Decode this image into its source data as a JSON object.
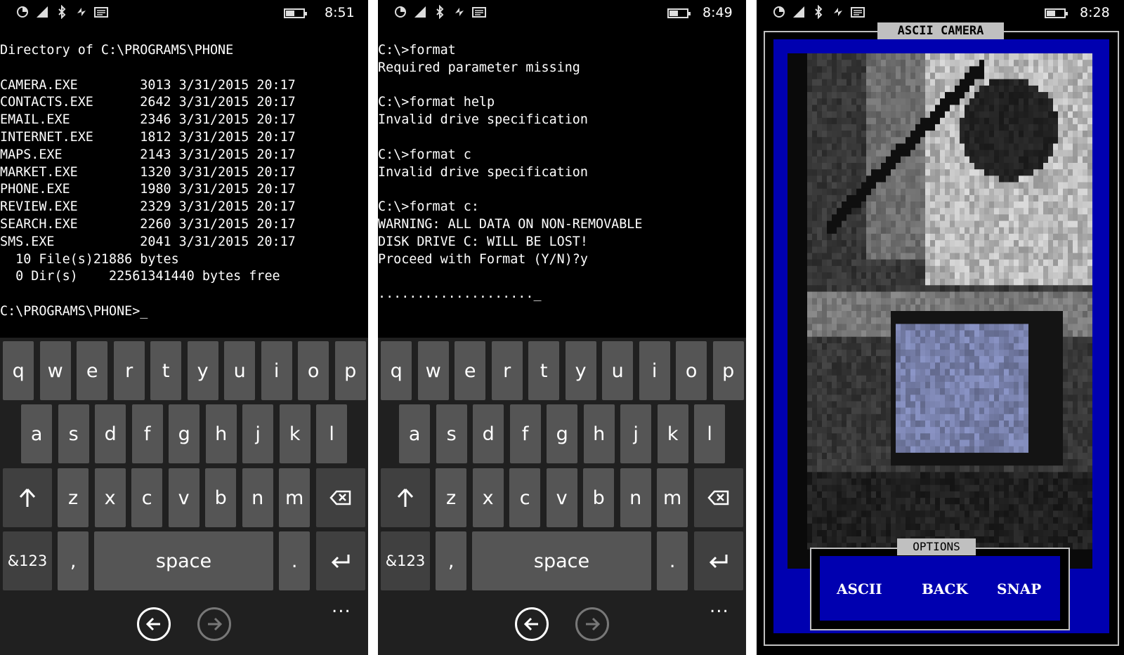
{
  "screens": [
    {
      "status": {
        "time": "8:51",
        "battery_level": 0.45
      },
      "terminal_lines": [
        "Directory of C:\\PROGRAMS\\PHONE",
        "",
        "CAMERA.EXE        3013 3/31/2015 20:17",
        "CONTACTS.EXE      2642 3/31/2015 20:17",
        "EMAIL.EXE         2346 3/31/2015 20:17",
        "INTERNET.EXE      1812 3/31/2015 20:17",
        "MAPS.EXE          2143 3/31/2015 20:17",
        "MARKET.EXE        1320 3/31/2015 20:17",
        "PHONE.EXE         1980 3/31/2015 20:17",
        "REVIEW.EXE        2329 3/31/2015 20:17",
        "SEARCH.EXE        2260 3/31/2015 20:17",
        "SMS.EXE           2041 3/31/2015 20:17",
        "  10 File(s)21886 bytes",
        "  0 Dir(s)    22561341440 bytes free",
        "",
        "C:\\PROGRAMS\\PHONE>_"
      ]
    },
    {
      "status": {
        "time": "8:49",
        "battery_level": 0.45
      },
      "terminal_lines": [
        "C:\\>format",
        "Required parameter missing",
        "",
        "C:\\>format help",
        "Invalid drive specification",
        "",
        "C:\\>format c",
        "Invalid drive specification",
        "",
        "C:\\>format c:",
        "WARNING: ALL DATA ON NON-REMOVABLE",
        "DISK DRIVE C: WILL BE LOST!",
        "Proceed with Format (Y/N)?y",
        "",
        "...................._"
      ]
    }
  ],
  "keyboard": {
    "row1": [
      "q",
      "w",
      "e",
      "r",
      "t",
      "y",
      "u",
      "i",
      "o",
      "p"
    ],
    "row2": [
      "a",
      "s",
      "d",
      "f",
      "g",
      "h",
      "j",
      "k",
      "l"
    ],
    "row3": [
      "z",
      "x",
      "c",
      "v",
      "b",
      "n",
      "m"
    ],
    "numbers_key": "&123",
    "comma_key": ",",
    "space_key": "space",
    "period_key": ".",
    "more_dots": "..."
  },
  "camera": {
    "status": {
      "time": "8:28",
      "battery_level": 0.45
    },
    "title": "ASCII CAMERA",
    "options_title": "OPTIONS",
    "buttons": {
      "ascii": "ASCII",
      "back": "BACK",
      "snap": "SNAP"
    }
  },
  "colors": {
    "key": "#555555",
    "fn_key": "#404040",
    "keyboard_bg": "#202020",
    "dos_blue": "#0000b0",
    "frame_gray": "#c0c0c0"
  }
}
